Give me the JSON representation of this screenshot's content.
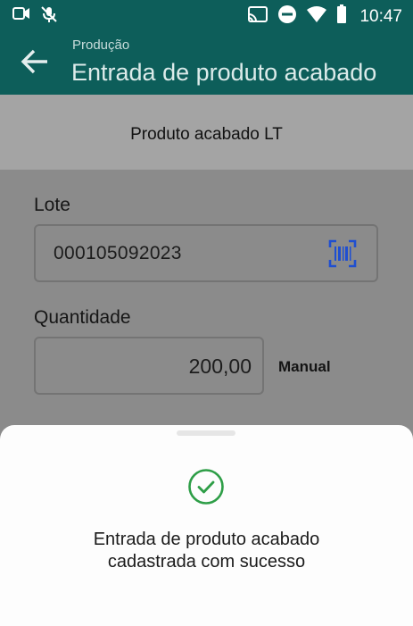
{
  "status_bar": {
    "time": "10:47",
    "icons": [
      "video-camera-icon",
      "mic-off-icon",
      "cast-icon",
      "do-not-disturb-icon",
      "wifi-icon",
      "battery-icon"
    ]
  },
  "app_bar": {
    "subtitle": "Produção",
    "title": "Entrada de produto acabado",
    "color": "#0d5e5a"
  },
  "section": {
    "title": "Produto acabado LT"
  },
  "form": {
    "lote": {
      "label": "Lote",
      "value": "000105092023"
    },
    "quantidade": {
      "label": "Quantidade",
      "value": "200,00",
      "mode": "Manual"
    }
  },
  "dialog": {
    "message_line1": "Entrada de produto acabado",
    "message_line2": "cadastrada com sucesso",
    "icon": "check-circle-icon",
    "success_color": "#2e9e47"
  },
  "colors": {
    "barcode_icon": "#1f4fd1"
  }
}
